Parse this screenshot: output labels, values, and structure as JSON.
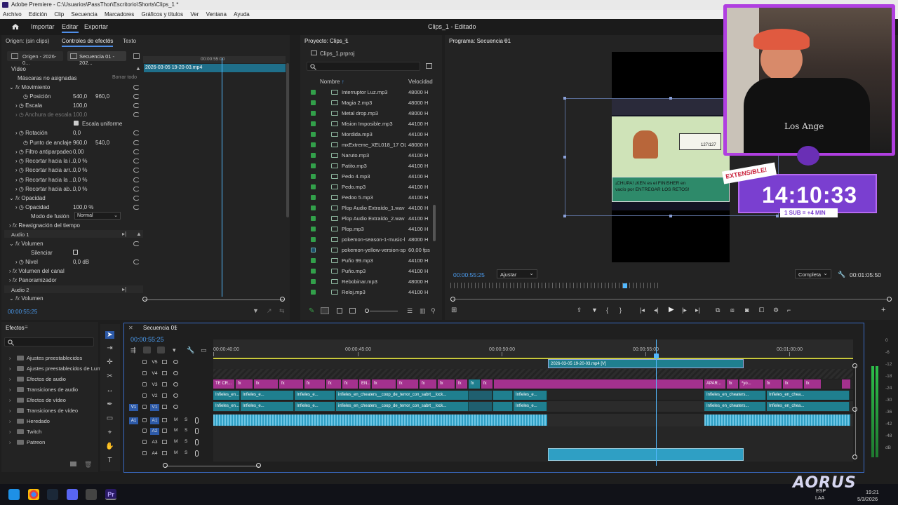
{
  "window": {
    "title": "Adobe Premiere - C:\\Usuarios\\PassThor\\Escritorio\\Shorts\\Clips_1 *"
  },
  "menu": [
    "Archivo",
    "Edición",
    "Clip",
    "Secuencia",
    "Marcadores",
    "Gráficos y títulos",
    "Ver",
    "Ventana",
    "Ayuda"
  ],
  "workspace": {
    "tabs": [
      "Importar",
      "Editar",
      "Exportar"
    ],
    "doc_title": "Clips_1 - Editado"
  },
  "source_panel": {
    "tabs": [
      "Origen: (sin clips)",
      "Controles de efectos",
      "Texto"
    ],
    "subtabs": [
      "Origen - 2026-0...",
      "Secuencia 01 - 202..."
    ],
    "clip_time": "00:00:55:00",
    "clip_name": "2026-03-05 19-20-03.mp4",
    "section_video": "Vídeo",
    "masks": "Máscaras no asignadas",
    "borrar": "Borrar todo",
    "movimiento": "Movimiento",
    "posicion": "Posición",
    "pos_x": "540,0",
    "pos_y": "960,0",
    "escala": "Escala",
    "escala_v": "100,0",
    "anchura": "Anchura de escala",
    "anchura_v": "100,0",
    "escala_uniforme": "Escala uniforme",
    "rotacion": "Rotación",
    "rot_v": "0,0",
    "punto": "Punto de anclaje",
    "punto_x": "960,0",
    "punto_y": "540,0",
    "filtro": "Filtro antiparpadeo",
    "filtro_v": "0,00",
    "rec1": "Recortar hacia la i...",
    "rec1_v": "0,0 %",
    "rec2": "Recortar hacia arr...",
    "rec2_v": "0,0 %",
    "rec3": "Recortar hacia la ...",
    "rec3_v": "0,0 %",
    "rec4": "Recortar hacia ab...",
    "rec4_v": "0,0 %",
    "opacidad": "Opacidad",
    "opacidad2": "Opacidad",
    "opacidad_v": "100,0 %",
    "modo": "Modo de fusión",
    "modo_v": "Normal",
    "reasig": "Reasignación del tiempo",
    "audio1": "Audio 1",
    "volumen": "Volumen",
    "silenciar": "Silenciar",
    "nivel": "Nivel",
    "nivel_v": "0,0 dB",
    "vol_canal": "Volumen del canal",
    "panorama": "Panoramizador",
    "audio2": "Audio 2",
    "volumen2": "Volumen",
    "timecode": "00:00:55:25"
  },
  "project_panel": {
    "tab": "Proyecto: Clips_1",
    "proj_file": "Clips_1.prproj",
    "col_name": "Nombre",
    "col_speed": "Velocidad",
    "files": [
      {
        "name": "Interruptor Luz.mp3",
        "speed": "48000 H"
      },
      {
        "name": "Magia 2.mp3",
        "speed": "48000 H"
      },
      {
        "name": "Metal drop.mp3",
        "speed": "48000 H"
      },
      {
        "name": "Mision Imposible.mp3",
        "speed": "44100 H"
      },
      {
        "name": "Mordida.mp3",
        "speed": "44100 H"
      },
      {
        "name": "mxExtreme_XEL018_17 OLD",
        "speed": "48000 H"
      },
      {
        "name": "Naruto.mp3",
        "speed": "44100 H"
      },
      {
        "name": "Patito.mp3",
        "speed": "44100 H"
      },
      {
        "name": "Pedo 4.mp3",
        "speed": "44100 H"
      },
      {
        "name": "Pedo.mp3",
        "speed": "44100 H"
      },
      {
        "name": "Pedoo 5.mp3",
        "speed": "44100 H"
      },
      {
        "name": "Plop Audio Extraído_1.wav",
        "speed": "44100 H"
      },
      {
        "name": "Plop Audio Extraído_2.wav",
        "speed": "44100 H"
      },
      {
        "name": "Plop.mp3",
        "speed": "44100 H"
      },
      {
        "name": "pokemon-season-1-music-l",
        "speed": "48000 H"
      },
      {
        "name": "pokemon-yellow-version-sp",
        "speed": "60,00 fps"
      },
      {
        "name": "Puño 99.mp3",
        "speed": "44100 H"
      },
      {
        "name": "Puño.mp3",
        "speed": "44100 H"
      },
      {
        "name": "Rebobinar.mp3",
        "speed": "48000 H"
      },
      {
        "name": "Reloj.mp3",
        "speed": "44100 H"
      }
    ]
  },
  "program_panel": {
    "tab": "Programa: Secuencia 01",
    "timecode": "00:00:55:25",
    "fit": "Ajustar",
    "quality": "Completa",
    "duration": "00:01:05:50",
    "overlay_caption": "¡CHUPA! ¡KEN es el FINISHER en vacío por ENTREGAR LOS RETOS!",
    "overlay_stat": "127/127"
  },
  "stream_overlay": {
    "badge": "EXTENSIBLE!",
    "timer": "14:10:33",
    "sub": "1 SUB = +4 MIN",
    "shirt": "Los Ange"
  },
  "effects_panel": {
    "tab": "Efectos",
    "items": [
      "Ajustes preestablecidos",
      "Ajustes preestablecidos de Lum",
      "Efectos de audio",
      "Transiciones de audio",
      "Efectos de vídeo",
      "Transiciones de vídeo",
      "Heredado",
      "Twitch",
      "Patreon"
    ]
  },
  "timeline": {
    "tab": "Secuencia 01",
    "timecode": "00:00:55:25",
    "ruler": [
      "00:00:40:00",
      "00:00:45:00",
      "00:00:50:00",
      "00:00:55:00",
      "00:01:00:00"
    ],
    "tracks_video": [
      "V5",
      "V4",
      "V3",
      "V2",
      "V1"
    ],
    "tracks_audio": [
      "A1",
      "A2",
      "A3",
      "A4"
    ],
    "v5_clip": "2026-03-05 19-20-03.mp4 [V]",
    "v3_clips": [
      "TE CR...",
      "fx",
      "fx",
      "fx",
      "fx",
      "fx",
      "fx",
      "EN...",
      "fx",
      "fx",
      "fx",
      "fx",
      "fx",
      "fx",
      "fx",
      "fx",
      "APAR...",
      "fx",
      "*yo...",
      "fx",
      "fx",
      "fx"
    ],
    "v2_labels": [
      "Infieles_en...",
      "Infieles_e...",
      "infieles_en_cheaters__coop_de_terror_con_sabrt__lock...",
      "Infieles_e...",
      "Infieles_en_cheaters...",
      "Infieles_en_chea..."
    ],
    "v1_labels": [
      "Infieles_en...",
      "Infieles_e...",
      "infieles_en_cheaters__coop_de_terror_con_sabrt__lock...",
      "Infieles_e...",
      "Infieles_en_cheaters...",
      "Infieles_en_chea..."
    ]
  },
  "meter_labels": [
    "0",
    "-6",
    "-12",
    "-18",
    "-24",
    "-30",
    "-36",
    "-42",
    "-48",
    "dB"
  ],
  "taskbar": {
    "lang": "ESP",
    "layout": "LAA",
    "time": "19:21",
    "date": "5/3/2026",
    "brand": "AORUS"
  },
  "colors": {
    "accent": "#4f8ee8",
    "clip_magenta": "#a4318e",
    "clip_teal": "#1f7f8f",
    "audio_clip": "#2f9fc4",
    "playhead": "#53b9ff"
  }
}
